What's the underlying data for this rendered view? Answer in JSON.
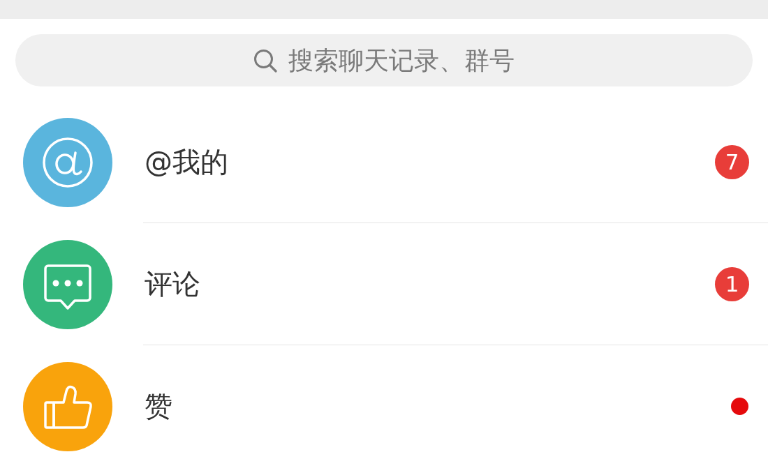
{
  "search": {
    "placeholder": "搜索聊天记录、群号"
  },
  "items": [
    {
      "kind": "at",
      "color": "#5ab5dd",
      "label": "@我的",
      "badge": {
        "kind": "count",
        "text": "7"
      }
    },
    {
      "kind": "comment",
      "color": "#34b77c",
      "label": "评论",
      "badge": {
        "kind": "count",
        "text": "1"
      }
    },
    {
      "kind": "like",
      "color": "#f9a30c",
      "label": "赞",
      "badge": {
        "kind": "dot"
      }
    }
  ]
}
